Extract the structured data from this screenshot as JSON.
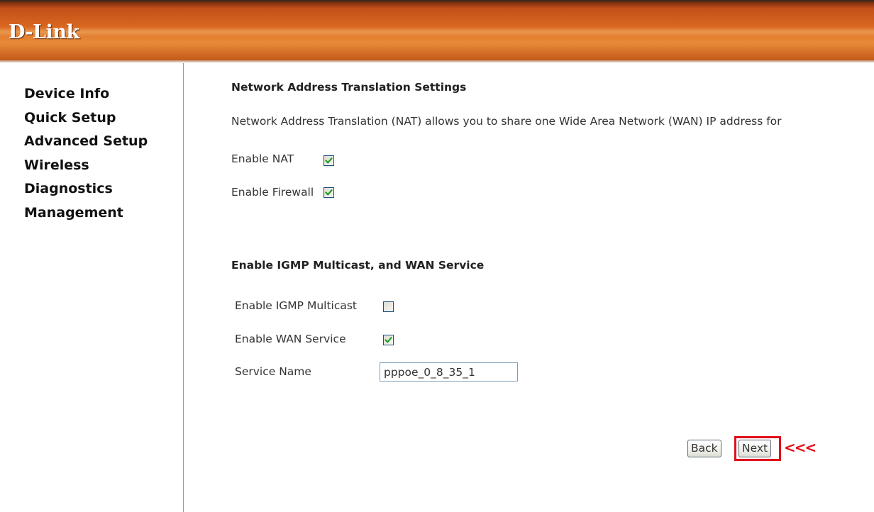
{
  "header": {
    "logo_text": "D-Link"
  },
  "sidebar": {
    "items": [
      {
        "label": "Device Info"
      },
      {
        "label": "Quick Setup"
      },
      {
        "label": "Advanced Setup"
      },
      {
        "label": "Wireless"
      },
      {
        "label": "Diagnostics"
      },
      {
        "label": "Management"
      }
    ]
  },
  "nat": {
    "title": "Network Address Translation Settings",
    "description": "Network Address Translation (NAT) allows you to share one Wide Area Network (WAN) IP address for",
    "enable_nat_label": "Enable NAT",
    "enable_nat_checked": true,
    "enable_firewall_label": "Enable Firewall",
    "enable_firewall_checked": true
  },
  "igmp": {
    "title": "Enable IGMP Multicast, and WAN Service",
    "enable_igmp_label": "Enable IGMP Multicast",
    "enable_igmp_checked": false,
    "enable_wan_label": "Enable WAN Service",
    "enable_wan_checked": true,
    "service_name_label": "Service Name",
    "service_name_value": "pppoe_0_8_35_1"
  },
  "actions": {
    "back_label": "Back",
    "next_label": "Next",
    "pointer_text": "<<<"
  },
  "colors": {
    "header_orange": "#d7651f",
    "highlight_red": "#e0101a",
    "checkbox_border": "#1c5180",
    "check_green": "#1f9e1f"
  }
}
